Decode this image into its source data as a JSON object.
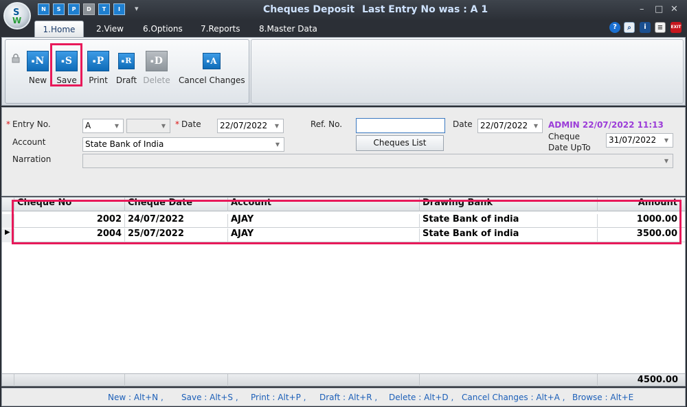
{
  "window": {
    "title": "Cheques Deposit",
    "last_entry": "Last Entry No was : A 1",
    "logo_s": "S",
    "logo_w": "W",
    "minimize": "–",
    "maximize": "□",
    "close": "✕"
  },
  "quick_access": [
    "N",
    "S",
    "P",
    "D",
    "T",
    "I"
  ],
  "tabs": [
    {
      "label": "1.Home",
      "active": true
    },
    {
      "label": "2.View",
      "active": false
    },
    {
      "label": "6.Options",
      "active": false
    },
    {
      "label": "7.Reports",
      "active": false
    },
    {
      "label": "8.Master Data",
      "active": false
    }
  ],
  "header_icons": [
    "help-icon",
    "find-icon",
    "info-icon",
    "document-icon",
    "exit-icon"
  ],
  "ribbon": {
    "buttons": [
      {
        "label": "New",
        "glyph": "N",
        "enabled": true
      },
      {
        "label": "Save",
        "glyph": "S",
        "enabled": true
      },
      {
        "label": "Print",
        "glyph": "P",
        "enabled": true
      },
      {
        "label": "Draft",
        "glyph": "R",
        "enabled": true
      },
      {
        "label": "Delete",
        "glyph": "D",
        "enabled": false
      },
      {
        "label": "Cancel Changes",
        "glyph": "A",
        "enabled": true
      }
    ]
  },
  "form": {
    "entry_no_label": "Entry No.",
    "entry_no_value": "A",
    "entry_suffix_value": "",
    "date_label": "Date",
    "date_value": "22/07/2022",
    "ref_no_label": "Ref. No.",
    "ref_no_value": "",
    "date2_label": "Date",
    "date2_value": "22/07/2022",
    "admin_stamp": "ADMIN 22/07/2022 11:13",
    "account_label": "Account",
    "account_value": "State Bank of India",
    "cheques_list_button": "Cheques List",
    "cheque_date_upto_label_1": "Cheque",
    "cheque_date_upto_label_2": "Date UpTo",
    "cheque_date_upto_value": "31/07/2022",
    "narration_label": "Narration",
    "narration_value": ""
  },
  "grid": {
    "columns": [
      "Cheque No",
      "Cheque Date",
      "Account",
      "Drawing Bank",
      "Amount"
    ],
    "rows": [
      {
        "cheque_no": "2002",
        "cheque_date": "24/07/2022",
        "account": "AJAY",
        "drawing_bank": "State Bank of india",
        "amount": "1000.00"
      },
      {
        "cheque_no": "2004",
        "cheque_date": "25/07/2022",
        "account": "AJAY",
        "drawing_bank": "State Bank of india",
        "amount": "3500.00"
      }
    ],
    "total_amount": "4500.00"
  },
  "shortcuts": [
    "New : Alt+N ,",
    "Save : Alt+S ,",
    "Print : Alt+P ,",
    "Draft : Alt+R ,",
    "Delete : Alt+D ,",
    "Cancel Changes : Alt+A ,",
    "Browse : Alt+E"
  ],
  "colors": {
    "highlight": "#e8195a",
    "admin_text": "#9b3cd8",
    "shortcut_text": "#1c5fb8",
    "ribbon_icon": "#1e7fd0"
  }
}
